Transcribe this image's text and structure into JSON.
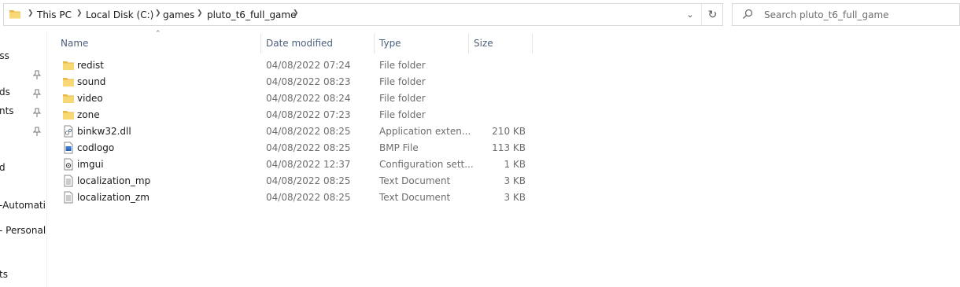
{
  "address_bar": {
    "crumbs": [
      "This PC",
      "Local Disk (C:)",
      "games",
      "pluto_t6_full_game"
    ]
  },
  "search": {
    "placeholder": "Search pluto_t6_full_game"
  },
  "nav_pane": {
    "items": [
      "ess",
      "ds",
      "nts",
      "d",
      "-Automati",
      "- Personal",
      "ts"
    ]
  },
  "columns": {
    "name": "Name",
    "date": "Date modified",
    "type": "Type",
    "size": "Size"
  },
  "files": [
    {
      "name": "redist",
      "date": "04/08/2022 07:24",
      "type": "File folder",
      "size": "",
      "icon": "folder-icon"
    },
    {
      "name": "sound",
      "date": "04/08/2022 08:23",
      "type": "File folder",
      "size": "",
      "icon": "folder-icon"
    },
    {
      "name": "video",
      "date": "04/08/2022 08:24",
      "type": "File folder",
      "size": "",
      "icon": "folder-icon"
    },
    {
      "name": "zone",
      "date": "04/08/2022 07:23",
      "type": "File folder",
      "size": "",
      "icon": "folder-icon"
    },
    {
      "name": "binkw32.dll",
      "date": "04/08/2022 08:25",
      "type": "Application exten...",
      "size": "210 KB",
      "icon": "dll-file-icon"
    },
    {
      "name": "codlogo",
      "date": "04/08/2022 08:25",
      "type": "BMP File",
      "size": "113 KB",
      "icon": "image-file-icon"
    },
    {
      "name": "imgui",
      "date": "04/08/2022 12:37",
      "type": "Configuration sett...",
      "size": "1 KB",
      "icon": "config-file-icon"
    },
    {
      "name": "localization_mp",
      "date": "04/08/2022 08:25",
      "type": "Text Document",
      "size": "3 KB",
      "icon": "text-file-icon"
    },
    {
      "name": "localization_zm",
      "date": "04/08/2022 08:25",
      "type": "Text Document",
      "size": "3 KB",
      "icon": "text-file-icon"
    }
  ],
  "colors": {
    "folder": "#f8d775",
    "folder_dark": "#e8b84a",
    "header_text": "#4c607a",
    "secondary_text": "#6d6d6d"
  }
}
